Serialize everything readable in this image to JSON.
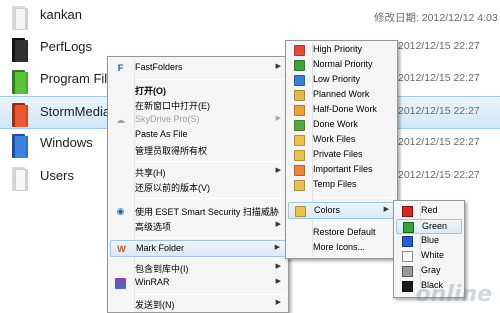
{
  "files": [
    {
      "name": "kankan",
      "date": "修改日期: 2012/12/12 4:03",
      "color": "#f0f0f0"
    },
    {
      "name": "PerfLogs",
      "date": "2012/12/15 22:27",
      "color": "#222222"
    },
    {
      "name": "Program Files",
      "date": "2012/12/15 22:27",
      "color": "#4caf2a"
    },
    {
      "name": "StormMedia",
      "date": "2012/12/15 22:27",
      "color": "#e0431d"
    },
    {
      "name": "Windows",
      "date": "2012/12/15 22:27",
      "color": "#2e6fd6"
    },
    {
      "name": "Users",
      "date": "2012/12/15 22:27",
      "color": "#e8e8e8"
    }
  ],
  "context_menu": {
    "fastfolders": "FastFolders",
    "open": "打开(O)",
    "open_new_window": "在新窗口中打开(E)",
    "skydrive": "SkyDrive Pro(S)",
    "paste_as_file": "Paste As File",
    "take_ownership": "管理员取得所有权",
    "share": "共享(H)",
    "restore_versions": "还原以前的版本(V)",
    "eset_scan": "使用 ESET Smart Security 扫描威胁",
    "advanced": "高级选项",
    "mark_folder": "Mark Folder",
    "include_library": "包含到库中(I)",
    "winrar": "WinRAR",
    "send_to": "发送到(N)"
  },
  "mark_submenu": {
    "items": [
      "High Priority",
      "Normal Priority",
      "Low Priority",
      "Planned Work",
      "Half-Done Work",
      "Done Work",
      "Work Files",
      "Private Files",
      "Important Files",
      "Temp Files"
    ],
    "icon_colors": [
      "#e24a3b",
      "#3aa33a",
      "#3a7fd6",
      "#e8b84a",
      "#e8a33a",
      "#5aa843",
      "#e8c24a",
      "#e8c24a",
      "#e8863a",
      "#e8c24a"
    ],
    "colors": "Colors",
    "restore_default": "Restore Default",
    "more_icons": "More Icons..."
  },
  "colors_submenu": {
    "items": [
      "Red",
      "Green",
      "Blue",
      "White",
      "Gray",
      "Black"
    ],
    "swatches": [
      "#d9261c",
      "#39a335",
      "#1f5fd1",
      "#f6f6f6",
      "#9a9a9a",
      "#1a1a1a"
    ]
  },
  "watermark": "online"
}
